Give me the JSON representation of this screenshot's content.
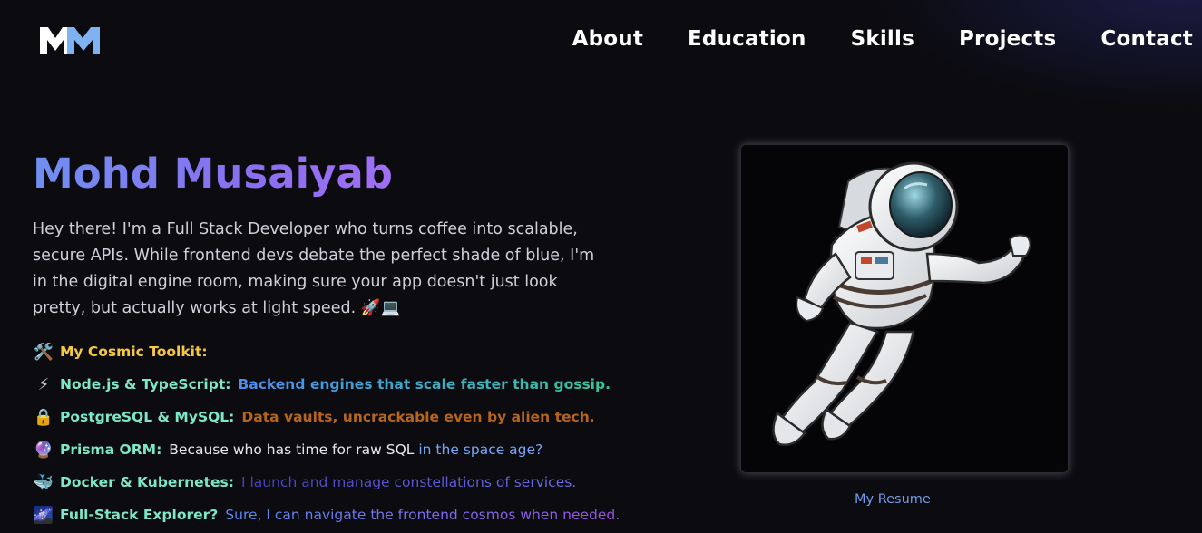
{
  "nav": {
    "items": [
      {
        "label": "About"
      },
      {
        "label": "Education"
      },
      {
        "label": "Skills"
      },
      {
        "label": "Projects"
      },
      {
        "label": "Contact"
      }
    ]
  },
  "hero": {
    "name": "Mohd Musaiyab",
    "intro": "Hey there! I'm a Full Stack Developer who turns coffee into scalable, secure APIs. While frontend devs debate the perfect shade of blue, I'm in the digital engine room, making sure your app doesn't just look pretty, but actually works at light speed. 🚀💻"
  },
  "toolkit": {
    "title_icon": "🛠️",
    "title": "My Cosmic Toolkit:",
    "items": [
      {
        "icon": "⚡",
        "label": "Node.js & TypeScript:",
        "desc": "Backend engines that scale faster than gossip."
      },
      {
        "icon": "🔒",
        "label": "PostgreSQL & MySQL:",
        "desc": "Data vaults, uncrackable even by alien tech."
      },
      {
        "icon": "🔮",
        "label": "Prisma ORM:",
        "desc_a": "Because who has time for raw SQL ",
        "desc_b": "in the space age?"
      },
      {
        "icon": "🐳",
        "label": "Docker & Kubernetes:",
        "desc": "I launch and manage constellations of services."
      },
      {
        "icon": "🌌",
        "label": "Full-Stack Explorer?",
        "desc": "Sure, I can navigate the frontend cosmos when needed."
      }
    ]
  },
  "resume_link": "My Resume",
  "colors": {
    "background": "#0b0b10",
    "accent_blue": "#6f8ff0",
    "accent_purple": "#a06ff5",
    "toolkit_title": "#f5c842",
    "skill_label": "#7ee8c6"
  }
}
